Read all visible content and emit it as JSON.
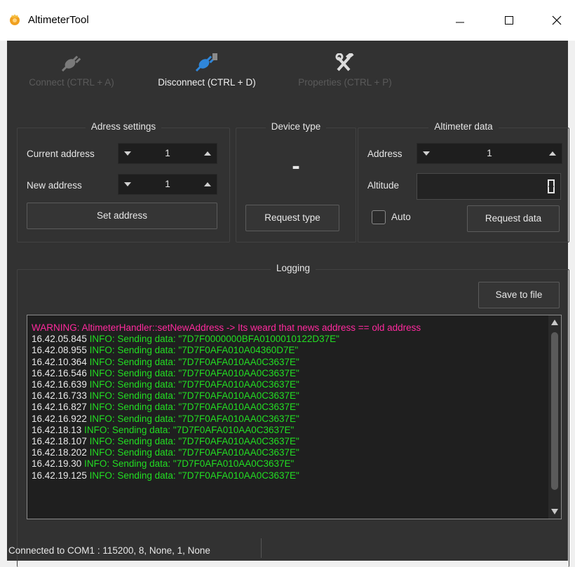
{
  "window": {
    "title": "AltimeterTool"
  },
  "toolbar": {
    "connect_label": "Connect (CTRL + A)",
    "disconnect_label": "Disconnect (CTRL + D)",
    "properties_label": "Properties (CTRL + P)"
  },
  "address_settings": {
    "title": "Adress settings",
    "current_address_label": "Current address",
    "current_address_value": "1",
    "new_address_label": "New address",
    "new_address_value": "1",
    "set_button": "Set address"
  },
  "device_type": {
    "title": "Device type",
    "value": "-",
    "request_button": "Request type"
  },
  "altimeter_data": {
    "title": "Altimeter data",
    "address_label": "Address",
    "address_value": "1",
    "altitude_label": "Altitude",
    "altitude_value": "",
    "auto_label": "Auto",
    "auto_checked": false,
    "request_button": "Request data"
  },
  "logging": {
    "title": "Logging",
    "save_button": "Save to file",
    "lines": [
      {
        "type": "warning",
        "time": "",
        "text": "WARNING: AltimeterHandler::setNewAddress -> Its weard that news address == old address"
      },
      {
        "type": "info",
        "time": "16.42.05.845",
        "text": "INFO: Sending data: \"7D7F0000000BFA0100010122D37E\""
      },
      {
        "type": "info",
        "time": "16.42.08.955",
        "text": "INFO: Sending data: \"7D7F0AFA010A04360D7E\""
      },
      {
        "type": "info",
        "time": "16.42.10.364",
        "text": "INFO: Sending data: \"7D7F0AFA010AA0C3637E\""
      },
      {
        "type": "info",
        "time": "16.42.16.546",
        "text": "INFO: Sending data: \"7D7F0AFA010AA0C3637E\""
      },
      {
        "type": "info",
        "time": "16.42.16.639",
        "text": "INFO: Sending data: \"7D7F0AFA010AA0C3637E\""
      },
      {
        "type": "info",
        "time": "16.42.16.733",
        "text": "INFO: Sending data: \"7D7F0AFA010AA0C3637E\""
      },
      {
        "type": "info",
        "time": "16.42.16.827",
        "text": "INFO: Sending data: \"7D7F0AFA010AA0C3637E\""
      },
      {
        "type": "info",
        "time": "16.42.16.922",
        "text": "INFO: Sending data: \"7D7F0AFA010AA0C3637E\""
      },
      {
        "type": "info",
        "time": "16.42.18.13",
        "text": "INFO: Sending data: \"7D7F0AFA010AA0C3637E\""
      },
      {
        "type": "info",
        "time": "16.42.18.107",
        "text": "INFO: Sending data: \"7D7F0AFA010AA0C3637E\""
      },
      {
        "type": "info",
        "time": "16.42.18.202",
        "text": "INFO: Sending data: \"7D7F0AFA010AA0C3637E\""
      },
      {
        "type": "info",
        "time": "16.42.19.30",
        "text": "INFO: Sending data: \"7D7F0AFA010AA0C3637E\""
      },
      {
        "type": "info",
        "time": "16.42.19.125",
        "text": "INFO: Sending data: \"7D7F0AFA010AA0C3637E\""
      }
    ]
  },
  "statusbar": {
    "text": "Connected to COM1 : 115200, 8, None, 1, None"
  },
  "icons": {
    "app": "app-icon",
    "connect": "plug-connect-icon",
    "disconnect": "plug-disconnect-icon",
    "properties": "tools-icon"
  },
  "colors": {
    "background": "#323232",
    "log_background": "#1f1f1f",
    "warning": "#ff2a9e",
    "info": "#22dd22"
  }
}
